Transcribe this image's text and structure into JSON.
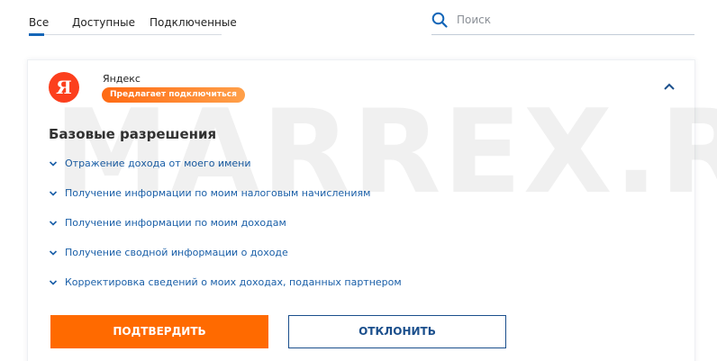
{
  "tabs": [
    {
      "label": "Все",
      "active": true
    },
    {
      "label": "Доступные",
      "active": false
    },
    {
      "label": "Подключенные",
      "active": false
    }
  ],
  "search": {
    "placeholder": "Поиск",
    "value": ""
  },
  "partner": {
    "name": "Яндекс",
    "logo_letter": "Я",
    "badge": "Предлагает подключиться",
    "logo_color": "#fc3f1d"
  },
  "permissions": {
    "title": "Базовые разрешения",
    "items": [
      "Отражение дохода от моего имени",
      "Получение информации по моим налоговым начислениям",
      "Получение информации по моим доходам",
      "Получение сводной информации о доходе",
      "Корректировка сведений о моих доходах, поданных партнером"
    ]
  },
  "actions": {
    "confirm": "ПОДТВЕРДИТЬ",
    "reject": "ОТКЛОНИТЬ"
  },
  "watermark": "MARREX.RU",
  "colors": {
    "accent_blue": "#1466b8",
    "link_blue": "#1a5fa8",
    "orange": "#ff6a00",
    "border_blue": "#1b4f8c"
  },
  "icons": {
    "search": "search-icon",
    "collapse": "chevron-up-icon",
    "item": "chevron-down-icon"
  }
}
